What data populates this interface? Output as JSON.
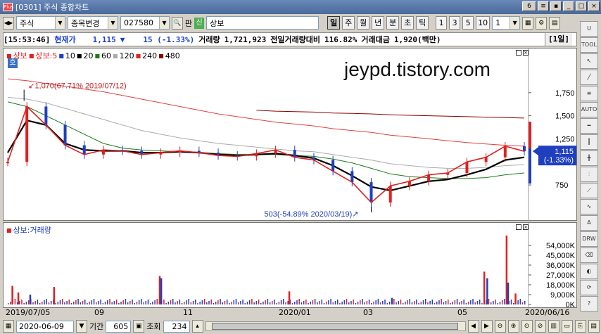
{
  "window": {
    "title": "[0301] 주식 종합차트"
  },
  "toolbar": {
    "market": "주식",
    "mode": "종목변경",
    "code": "027580",
    "pan_label": "판",
    "badge": "신",
    "stock_name": "상보",
    "periods": [
      "일",
      "주",
      "월",
      "년",
      "분",
      "초",
      "틱"
    ],
    "active_period": "일",
    "interval_buttons": [
      "1",
      "3",
      "5",
      "10"
    ],
    "interval_value": "1",
    "window_count": "6"
  },
  "info": {
    "time": "[15:53:46]",
    "price_label": "현재가",
    "price": "1,115",
    "change_arrow": "▼",
    "change": "15 (-1.33%)",
    "volume_label": "거래량",
    "volume": "1,721,923",
    "ratio_label": "전일거래량대비",
    "ratio": "116.82%",
    "amount_label": "거래대금",
    "amount": "1,920(백만)",
    "period_tag": "[1일]"
  },
  "price_panel": {
    "legend": [
      {
        "label": "상보",
        "color": "#e02020"
      },
      {
        "label": "상보:5",
        "color": "#e02020"
      },
      {
        "label": "10",
        "color": "#1f3fbf"
      },
      {
        "label": "20",
        "color": "#000000"
      },
      {
        "label": "60",
        "color": "#1a7a1a"
      },
      {
        "label": "120",
        "color": "#aaaaaa"
      },
      {
        "label": "240",
        "color": "#e02020"
      },
      {
        "label": "480",
        "color": "#8b0000"
      }
    ],
    "ho_badge": "호",
    "watermark": "jeypd.tistory.com",
    "high_note": "1,070(67.71% 2019/07/12)",
    "low_note": "503(-54.89% 2020/03/19)",
    "y_ticks": [
      "1,750",
      "1,500",
      "1,250",
      "750"
    ],
    "current_price_tag": "1,115",
    "current_change_tag": "(-1.33%)"
  },
  "volume_panel": {
    "legend": "상보:거래량",
    "y_ticks": [
      "54,000K",
      "45,000K",
      "36,000K",
      "27,000K",
      "18,000K",
      "9,000K",
      "0K"
    ]
  },
  "date_axis": {
    "labels": [
      "2019/07/05",
      "09",
      "11",
      "2020/01",
      "03",
      "05",
      "2020/06/16"
    ]
  },
  "bottom": {
    "date": "2020-06-09",
    "period_label": "기간",
    "period_value": "605",
    "view_label": "조회",
    "view_value": "234"
  },
  "colors": {
    "up": "#e02020",
    "down": "#1f3fbf",
    "ma5": "#e02020",
    "ma20": "#000000",
    "ma60": "#1a7a1a",
    "ma120": "#aaaaaa",
    "ma240": "#e04040",
    "ma480": "#8b0000"
  },
  "chart_data": {
    "type": "line",
    "price_series": {
      "name": "상보",
      "x": [
        "2019/07/05",
        "2019/07/12",
        "2019/07/20",
        "2019/08/01",
        "2019/08/15",
        "2019/09/01",
        "2019/09/15",
        "2019/10/01",
        "2019/10/15",
        "2019/11/01",
        "2019/11/15",
        "2019/12/01",
        "2019/12/15",
        "2020/01/01",
        "2020/01/15",
        "2020/02/01",
        "2020/02/15",
        "2020/03/01",
        "2020/03/10",
        "2020/03/19",
        "2020/04/01",
        "2020/04/15",
        "2020/05/01",
        "2020/05/15",
        "2020/05/25",
        "2020/06/01",
        "2020/06/09",
        "2020/06/16"
      ],
      "close": [
        1000,
        1600,
        1400,
        1180,
        1080,
        1130,
        1120,
        1080,
        1100,
        1120,
        1100,
        1070,
        1060,
        1090,
        1130,
        1050,
        1020,
        900,
        780,
        560,
        740,
        790,
        860,
        880,
        1000,
        1050,
        1170,
        1115
      ]
    },
    "ma20": [
      1100,
      1450,
      1400,
      1200,
      1130,
      1120,
      1120,
      1100,
      1100,
      1110,
      1100,
      1080,
      1070,
      1080,
      1090,
      1070,
      1040,
      960,
      850,
      730,
      690,
      740,
      790,
      810,
      860,
      920,
      1020,
      1050
    ],
    "ma60": [
      1650,
      1600,
      1500,
      1400,
      1300,
      1200,
      1150,
      1130,
      1120,
      1110,
      1100,
      1090,
      1080,
      1080,
      1080,
      1070,
      1060,
      1030,
      990,
      930,
      870,
      840,
      830,
      820,
      820,
      830,
      860,
      880
    ],
    "ma120": [
      1700,
      1680,
      1640,
      1580,
      1520,
      1460,
      1400,
      1340,
      1300,
      1260,
      1230,
      1200,
      1180,
      1160,
      1140,
      1120,
      1110,
      1080,
      1050,
      1020,
      980,
      960,
      940,
      930,
      930,
      940,
      960,
      970
    ],
    "ma240": [
      1900,
      1880,
      1850,
      1820,
      1790,
      1760,
      1720,
      1680,
      1640,
      1600,
      1560,
      1520,
      1490,
      1460,
      1430,
      1410,
      1390,
      1360,
      1340,
      1320,
      1290,
      1270,
      1250,
      1230,
      1210,
      1195,
      1180,
      1170
    ],
    "ma480": [
      null,
      null,
      null,
      null,
      null,
      null,
      null,
      null,
      null,
      null,
      null,
      null,
      null,
      1560,
      1550,
      1545,
      1540,
      1530,
      1525,
      1520,
      1510,
      1505,
      1500,
      1495,
      1490,
      1485,
      1480,
      1475
    ],
    "volume": {
      "unit": "K",
      "bars": [
        {
          "x": "2019/07/08",
          "value": 17000,
          "dir": "up"
        },
        {
          "x": "2019/07/12",
          "value": 11000,
          "dir": "up"
        },
        {
          "x": "2019/07/20",
          "value": 9000,
          "dir": "down"
        },
        {
          "x": "2019/08/05",
          "value": 16000,
          "dir": "up"
        },
        {
          "x": "2019/10/15",
          "value": 26000,
          "dir": "up"
        },
        {
          "x": "2019/10/16",
          "value": 24000,
          "dir": "down"
        },
        {
          "x": "2020/01/10",
          "value": 12000,
          "dir": "up"
        },
        {
          "x": "2020/03/19",
          "value": 6000,
          "dir": "down"
        },
        {
          "x": "2020/05/20",
          "value": 30000,
          "dir": "up"
        },
        {
          "x": "2020/05/22",
          "value": 24000,
          "dir": "down"
        },
        {
          "x": "2020/06/04",
          "value": 63000,
          "dir": "up"
        },
        {
          "x": "2020/06/05",
          "value": 20000,
          "dir": "down"
        },
        {
          "x": "2020/06/10",
          "value": 10000,
          "dir": "up"
        }
      ],
      "ylim": [
        0,
        63000
      ]
    },
    "ylim": [
      400,
      2000
    ]
  }
}
